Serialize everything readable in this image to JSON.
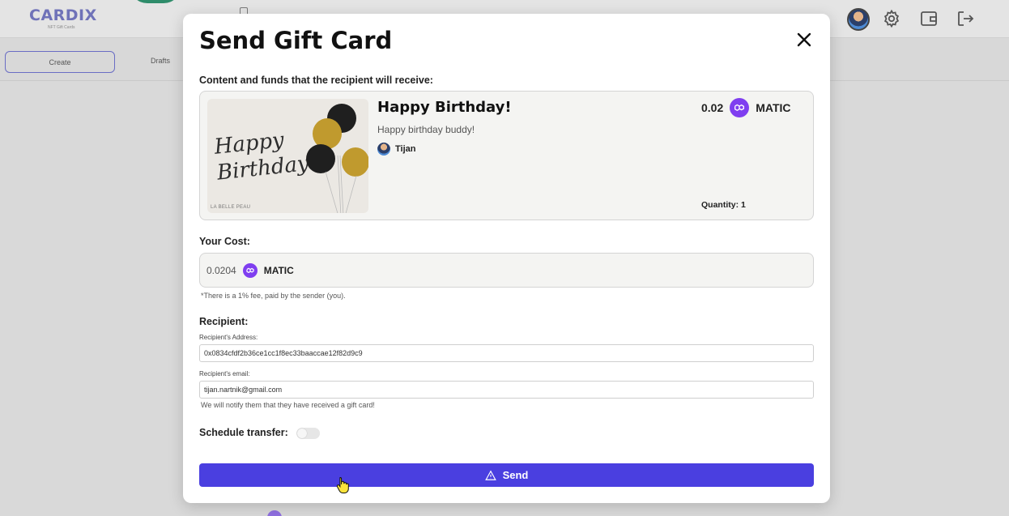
{
  "app": {
    "logo": "CARDIX",
    "logo_tagline": "NFT Gift Cards",
    "tabs": [
      {
        "label": "Create"
      },
      {
        "label": "Drafts"
      }
    ],
    "header_icons": [
      "avatar",
      "gear-icon",
      "wallet-icon",
      "logout-icon"
    ]
  },
  "modal": {
    "title": "Send Gift Card",
    "content_label": "Content and funds that the recipient will receive:",
    "card": {
      "image_script": "Happy Birthday!",
      "image_brand": "LA BELLE PEAU",
      "title": "Happy Birthday!",
      "message": "Happy birthday buddy!",
      "sender": "Tijan",
      "amount": "0.02",
      "token": "MATIC",
      "quantity": "Quantity: 1"
    },
    "cost": {
      "label": "Your Cost:",
      "value": "0.0204",
      "token": "MATIC",
      "fee_note": "*There is a 1% fee, paid by the sender (you)."
    },
    "recipient": {
      "label": "Recipient:",
      "address_label": "Recipient's Address:",
      "address": "0x0834cfdf2b36ce1cc1f8ec33baaccae12f82d9c9",
      "email_label": "Recipient's email:",
      "email": "tijan.nartnik@gmail.com",
      "email_note": "We will notify them that they have received a gift card!"
    },
    "schedule": {
      "label": "Schedule transfer:",
      "enabled": false
    },
    "send_label": "Send",
    "colors": {
      "accent": "#4a3fe0",
      "matic": "#7f3ef0"
    }
  }
}
